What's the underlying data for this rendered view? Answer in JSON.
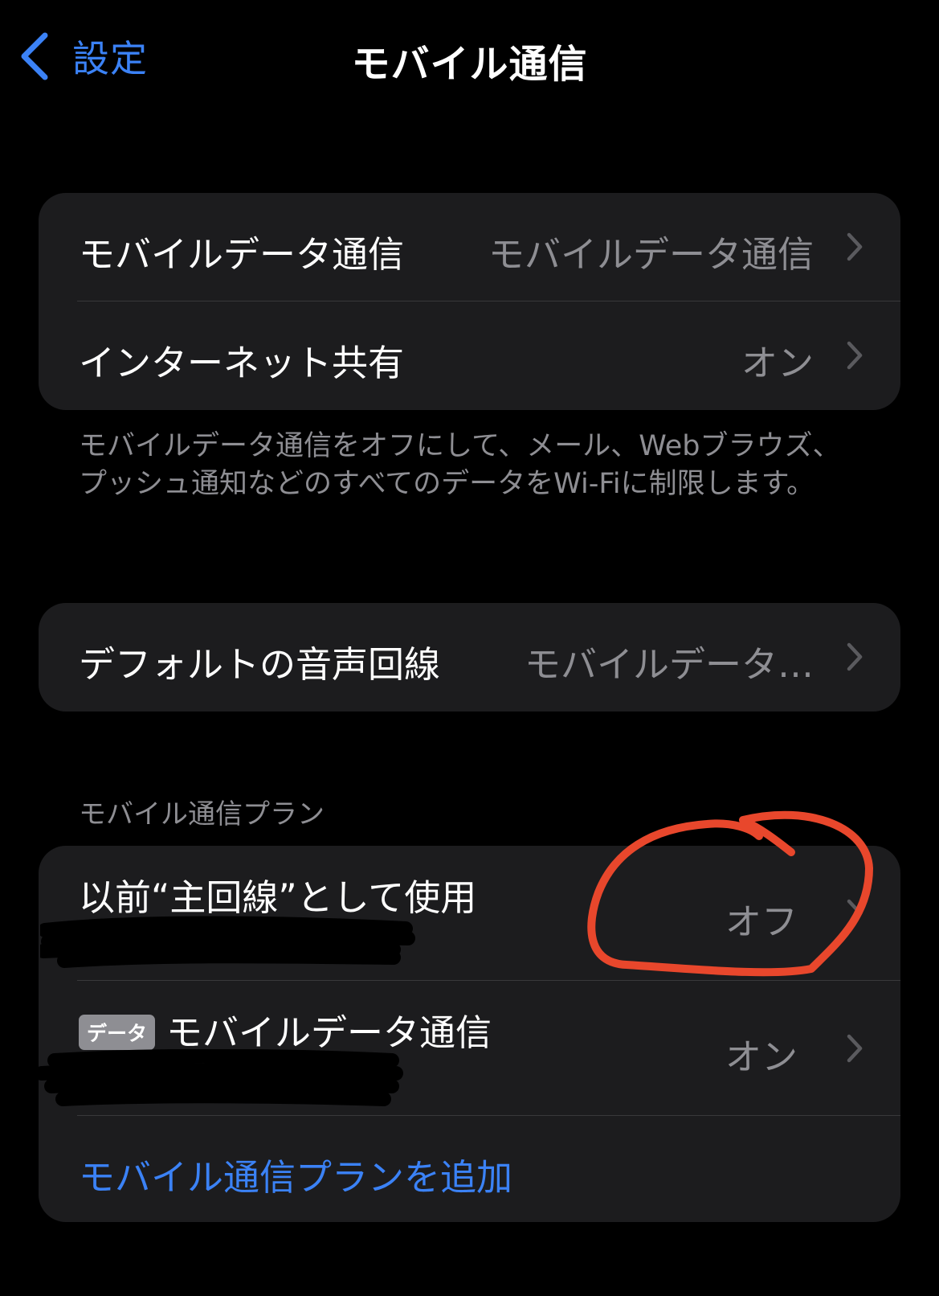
{
  "nav": {
    "back_label": "設定",
    "title": "モバイル通信"
  },
  "group1": {
    "rows": [
      {
        "label": "モバイルデータ通信",
        "value": "モバイルデータ通信"
      },
      {
        "label": "インターネット共有",
        "value": "オン"
      }
    ]
  },
  "footer_note": "モバイルデータ通信をオフにして、メール、Webブラウズ、プッシュ通知などのすべてのデータをWi-Fiに制限します。",
  "group2": {
    "rows": [
      {
        "label": "デフォルトの音声回線",
        "value": "モバイルデータ…"
      }
    ]
  },
  "plans_section": {
    "header": "モバイル通信プラン",
    "rows": [
      {
        "label": "以前“主回線”として使用",
        "value": "オフ"
      },
      {
        "badge": "データ",
        "label": "モバイルデータ通信",
        "value": "オン"
      }
    ],
    "add_label": "モバイル通信プランを追加"
  },
  "colors": {
    "background": "#000000",
    "cell": "#1c1c1e",
    "accent": "#3b82f6",
    "secondary_text": "#8e8e93",
    "annotation": "#e8472c"
  },
  "icons": [
    "chevron-left-icon",
    "chevron-right-icon"
  ]
}
